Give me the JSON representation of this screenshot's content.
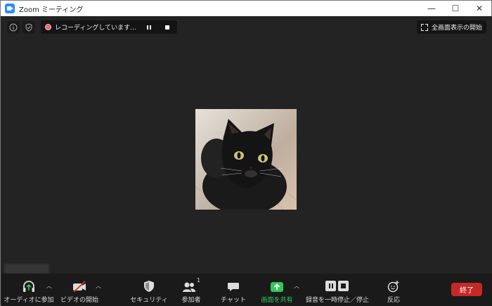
{
  "window": {
    "title": "Zoom ミーティング",
    "controls": {
      "minimize": "—",
      "maximize": "☐",
      "close": "✕"
    }
  },
  "meeting": {
    "recording": {
      "status": "レコーディングしています..."
    },
    "fullscreen_label": "全画面表示の開始",
    "participant_name": ""
  },
  "toolbar": {
    "audio_label": "オーディオに参加",
    "video_label": "ビデオの開始",
    "security_label": "セキュリティ",
    "participants_label": "参加者",
    "participants_count": "1",
    "chat_label": "チャット",
    "share_label": "画面を共有",
    "record_label": "録音を一時停止／停止",
    "reactions_label": "反応",
    "end_label": "終了"
  },
  "colors": {
    "background": "#232323",
    "toolbar": "#1a1a1a",
    "share_green": "#34c759",
    "end_red": "#c62828",
    "recording_dot": "#e46d6d"
  }
}
